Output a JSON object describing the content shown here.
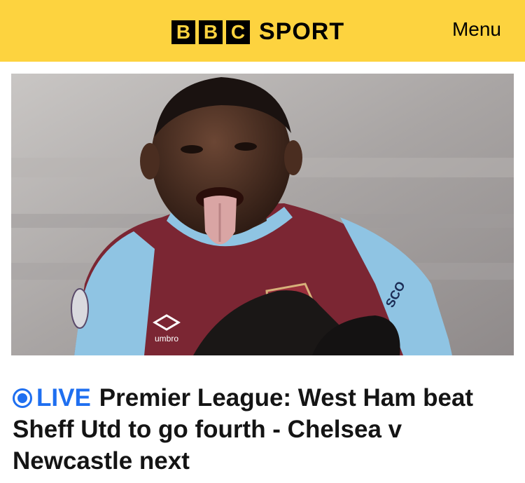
{
  "header": {
    "brand_letters": [
      "B",
      "B",
      "C"
    ],
    "brand_word": "SPORT",
    "menu_label": "Menu",
    "background_color": "#fdd33f"
  },
  "article": {
    "image_alt": "West Ham player celebrating",
    "live_icon": "live-indicator-icon",
    "live_label": "LIVE",
    "headline": "Premier League: West Ham beat Sheff Utd to go fourth - Chelsea v Newcastle next",
    "accent_color": "#1f6ff0"
  }
}
